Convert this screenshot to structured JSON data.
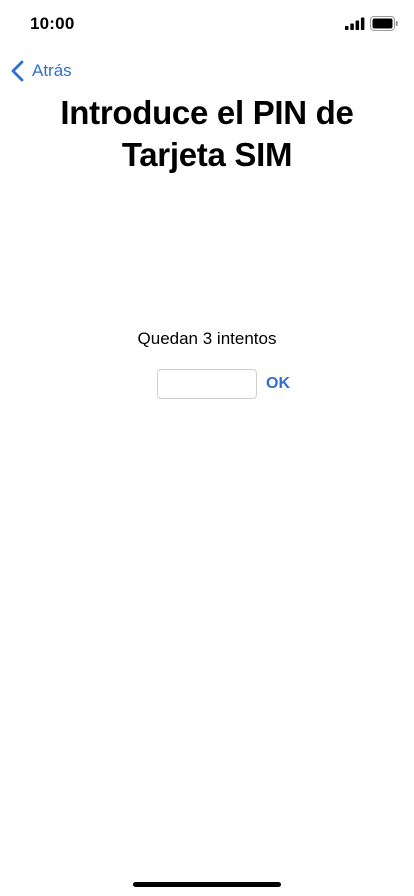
{
  "status_bar": {
    "time": "10:00",
    "signal_icon": "cellular-signal-icon",
    "battery_icon": "battery-full-icon"
  },
  "nav": {
    "back_icon": "chevron-left-icon",
    "back_label": "Atrás"
  },
  "title": "Introduce el PIN de Tarjeta SIM",
  "attempts_text": "Quedan 3 intentos",
  "pin_field": {
    "value": "",
    "placeholder": ""
  },
  "ok_label": "OK",
  "colors": {
    "accent": "#2f6fd0",
    "text": "#000000",
    "background": "#ffffff",
    "input_border": "#cfcfcf"
  }
}
